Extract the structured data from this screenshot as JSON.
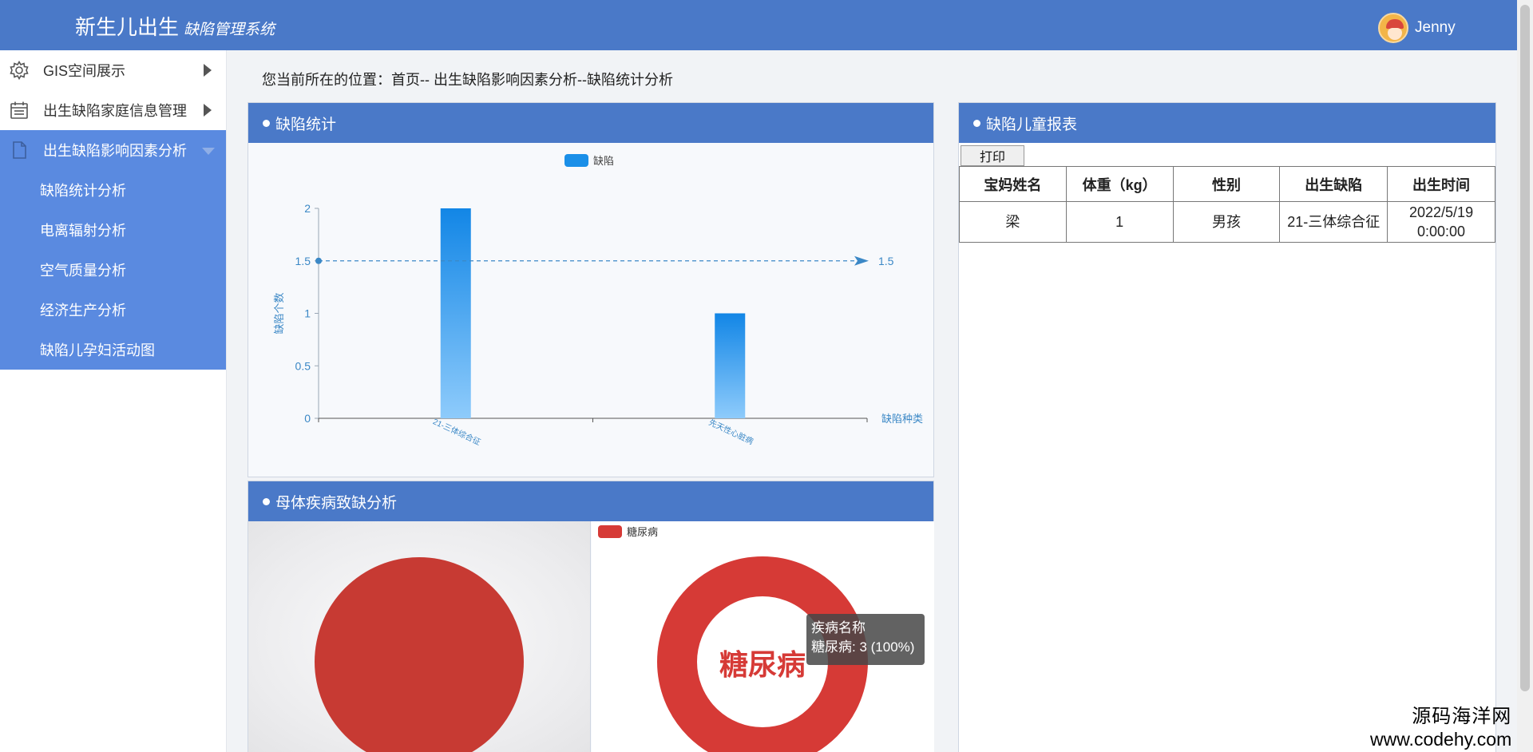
{
  "header": {
    "title": "新生儿出生",
    "subtitle": "缺陷管理系统",
    "user": "Jenny"
  },
  "sidebar": {
    "items": [
      {
        "label": "GIS空间展示",
        "icon": "gear-icon"
      },
      {
        "label": "出生缺陷家庭信息管理",
        "icon": "calendar-icon"
      },
      {
        "label": "出生缺陷影响因素分析",
        "icon": "document-icon"
      }
    ],
    "subitems": [
      {
        "label": "缺陷统计分析"
      },
      {
        "label": "电离辐射分析"
      },
      {
        "label": "空气质量分析"
      },
      {
        "label": "经济生产分析"
      },
      {
        "label": "缺陷儿孕妇活动图"
      }
    ]
  },
  "breadcrumb": "您当前所在的位置：首页--   出生缺陷影响因素分析--缺陷统计分析",
  "panels": {
    "stats_title": "缺陷统计",
    "disease_title": "母体疾病致缺分析",
    "report_title": "缺陷儿童报表"
  },
  "report": {
    "print_label": "打印",
    "columns": [
      "宝妈姓名",
      "体重（kg）",
      "性别",
      "出生缺陷",
      "出生时间"
    ],
    "rows": [
      [
        "梁",
        "1",
        "男孩",
        "21-三体综合征",
        "2022/5/19 0:00:00"
      ]
    ]
  },
  "chart_data": [
    {
      "type": "bar",
      "legend": [
        "缺陷"
      ],
      "categories": [
        "21-三体综合征",
        "先天性心脏病"
      ],
      "series": [
        {
          "name": "缺陷",
          "values": [
            2,
            1
          ]
        }
      ],
      "xlabel": "缺陷种类",
      "ylabel": "缺陷个数",
      "ylim": [
        0,
        2
      ],
      "yticks": [
        "0",
        "0.5",
        "1",
        "1.5",
        "2"
      ],
      "markline": {
        "value": 1.5,
        "label": "1.5"
      },
      "color": "#1a8fe8"
    },
    {
      "type": "pie",
      "labels": [
        "糖尿病"
      ],
      "values": [
        3
      ],
      "color": "#c73a33"
    },
    {
      "type": "pie",
      "legend": [
        "糖尿病"
      ],
      "labels": [
        "糖尿病"
      ],
      "values": [
        3
      ],
      "center_label": "糖尿病",
      "tooltip_title": "疾病名称",
      "tooltip_text": "糖尿病: 3 (100%)",
      "color": "#d63a36"
    }
  ],
  "watermark": {
    "line1": "源码海洋网",
    "line2": "www.codehy.com"
  }
}
